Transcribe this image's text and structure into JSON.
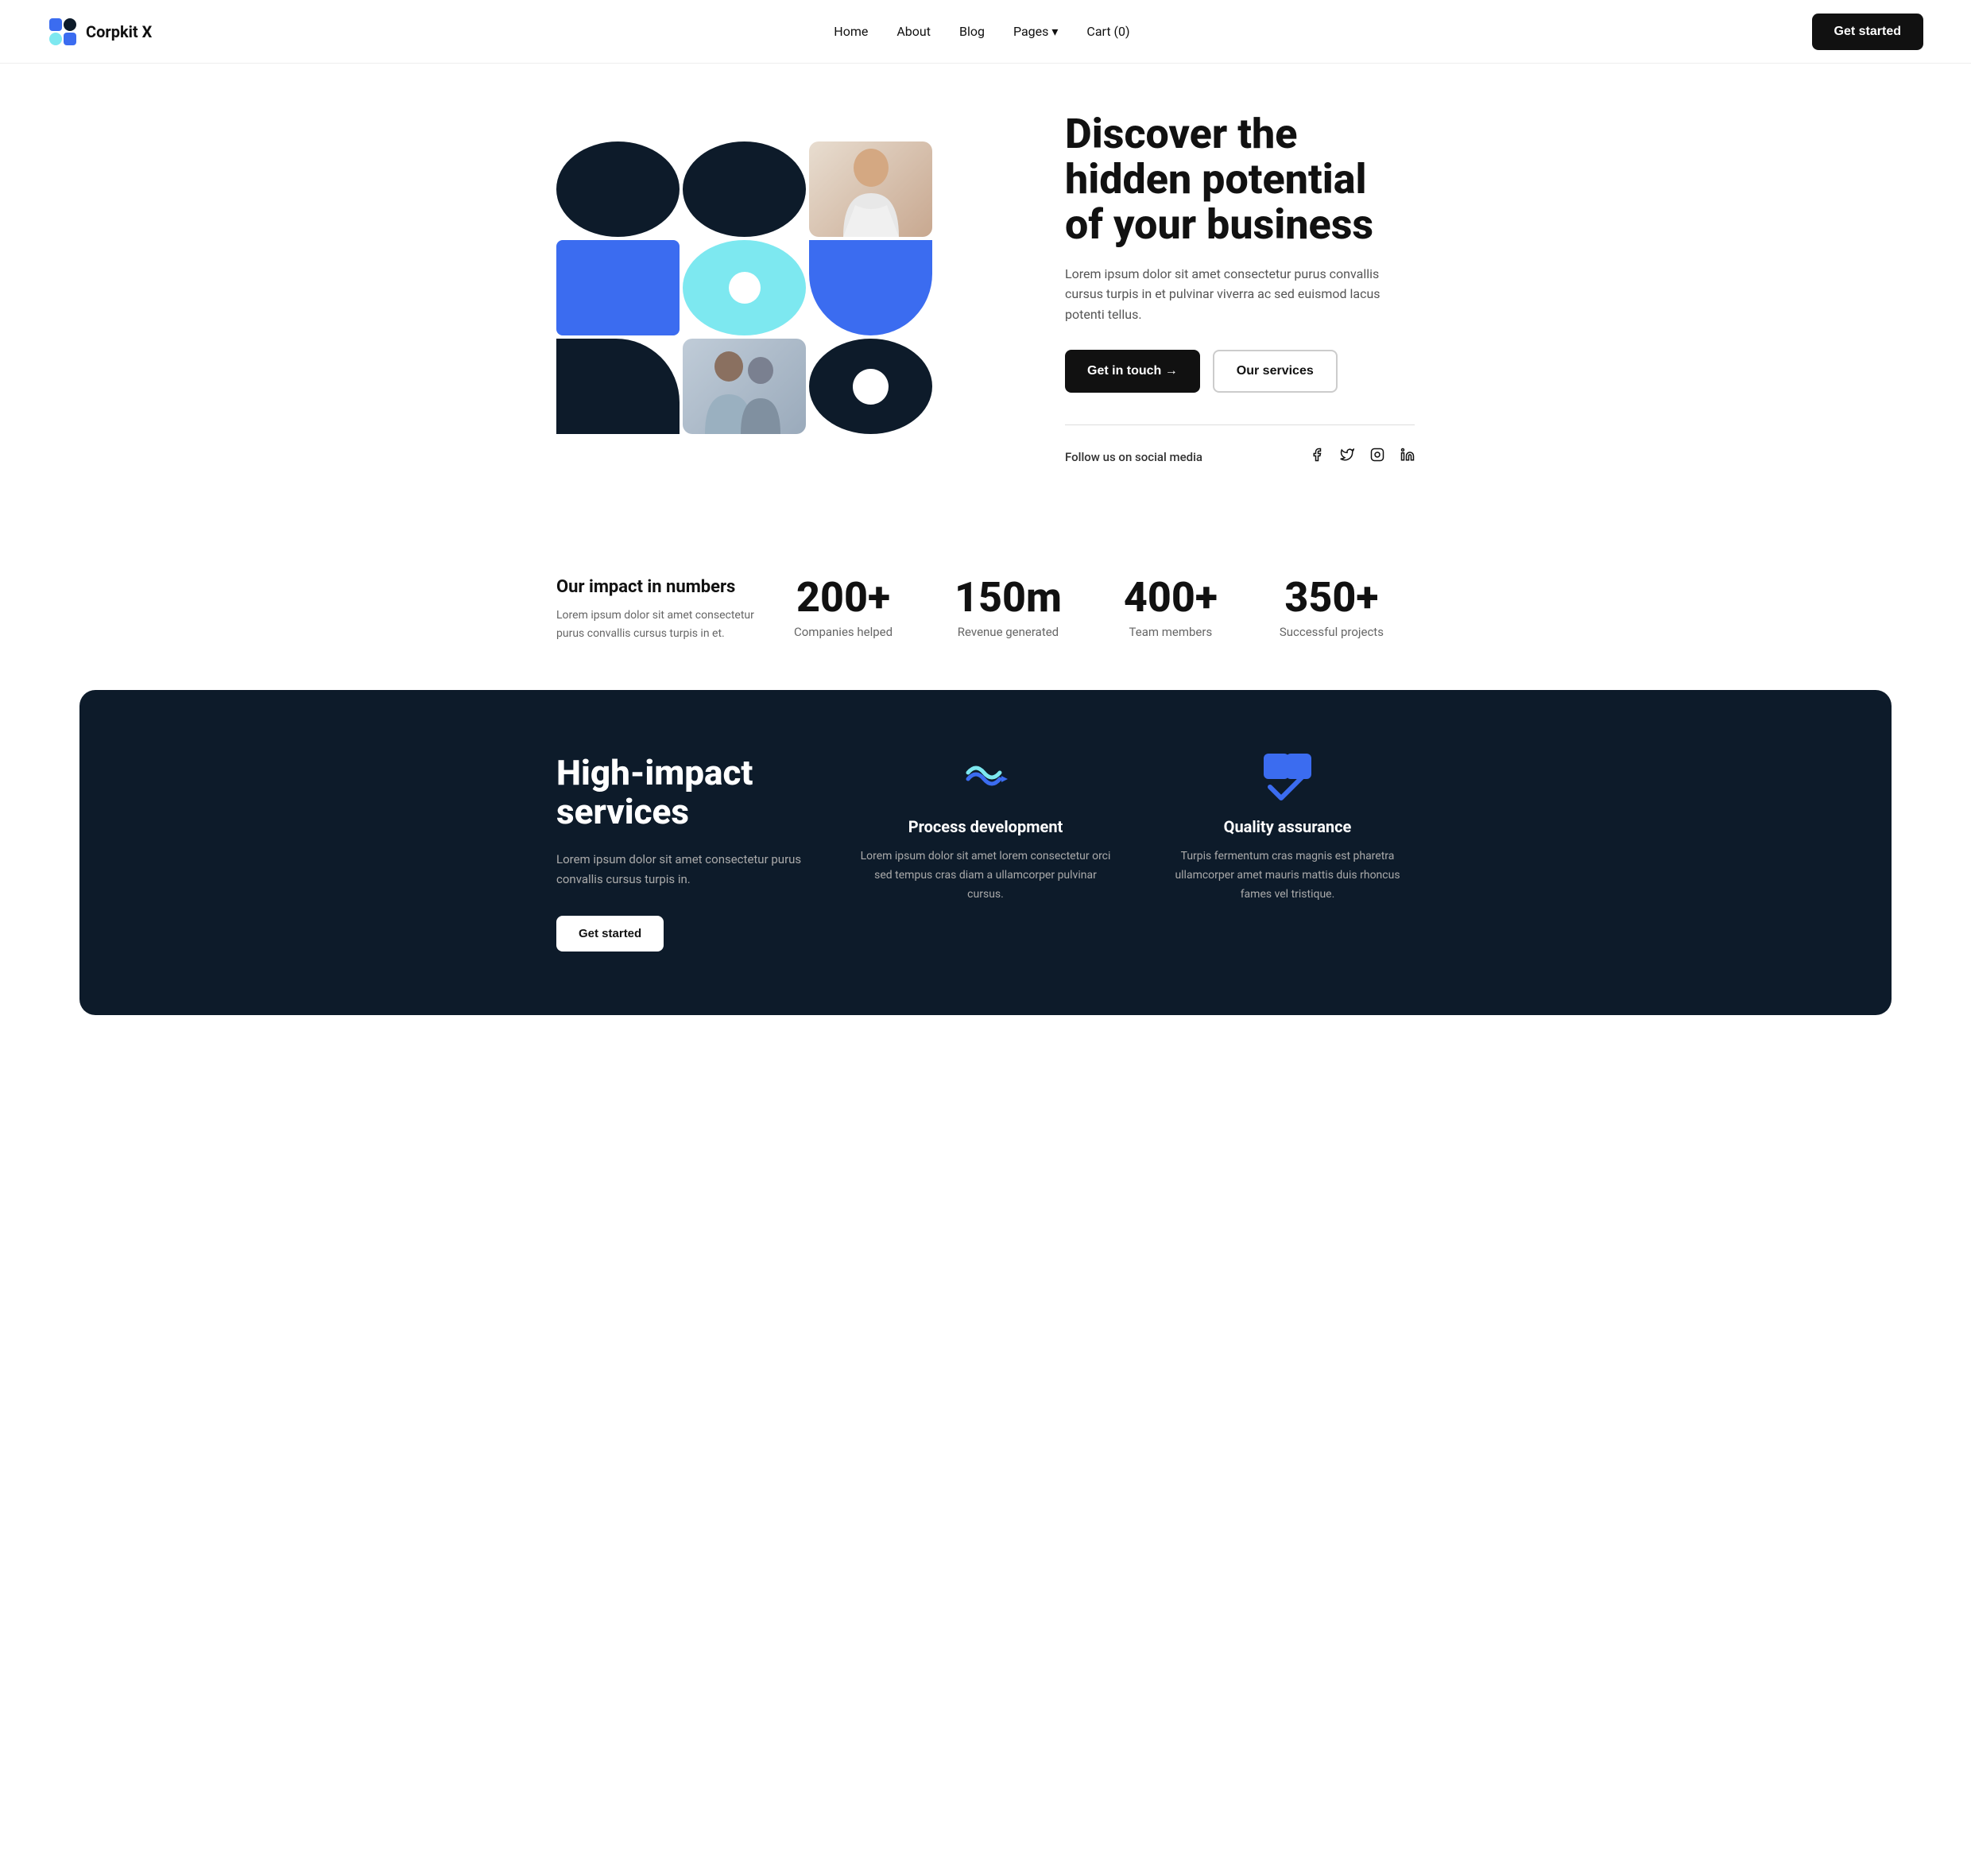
{
  "brand": {
    "name": "Corpkit X"
  },
  "nav": {
    "links": [
      {
        "label": "Home",
        "href": "#"
      },
      {
        "label": "About",
        "href": "#"
      },
      {
        "label": "Blog",
        "href": "#"
      },
      {
        "label": "Pages",
        "href": "#"
      },
      {
        "label": "Cart (0)",
        "href": "#"
      }
    ],
    "cta_label": "Get started"
  },
  "hero": {
    "title": "Discover the hidden potential of your business",
    "description": "Lorem ipsum dolor sit amet consectetur purus convallis cursus turpis in et pulvinar viverra ac sed euismod lacus potenti tellus.",
    "cta_primary": "Get in touch →",
    "cta_secondary": "Our services",
    "social_label": "Follow us on social media"
  },
  "stats": {
    "intro_title": "Our impact in numbers",
    "intro_desc": "Lorem ipsum dolor sit amet consectetur purus convallis cursus turpis in et.",
    "items": [
      {
        "number": "200+",
        "label": "Companies helped"
      },
      {
        "number": "150m",
        "label": "Revenue generated"
      },
      {
        "number": "400+",
        "label": "Team members"
      },
      {
        "number": "350+",
        "label": "Successful projects"
      }
    ]
  },
  "dark_section": {
    "title": "High-impact services",
    "description": "Lorem ipsum dolor sit amet consectetur purus convallis cursus turpis in.",
    "cta_label": "Get started",
    "services": [
      {
        "name": "Process development",
        "description": "Lorem ipsum dolor sit amet lorem consectetur orci sed tempus cras diam a ullamcorper pulvinar cursus."
      },
      {
        "name": "Quality assurance",
        "description": "Turpis fermentum cras magnis est pharetra ullamcorper amet mauris mattis duis rhoncus fames vel tristique."
      }
    ]
  }
}
